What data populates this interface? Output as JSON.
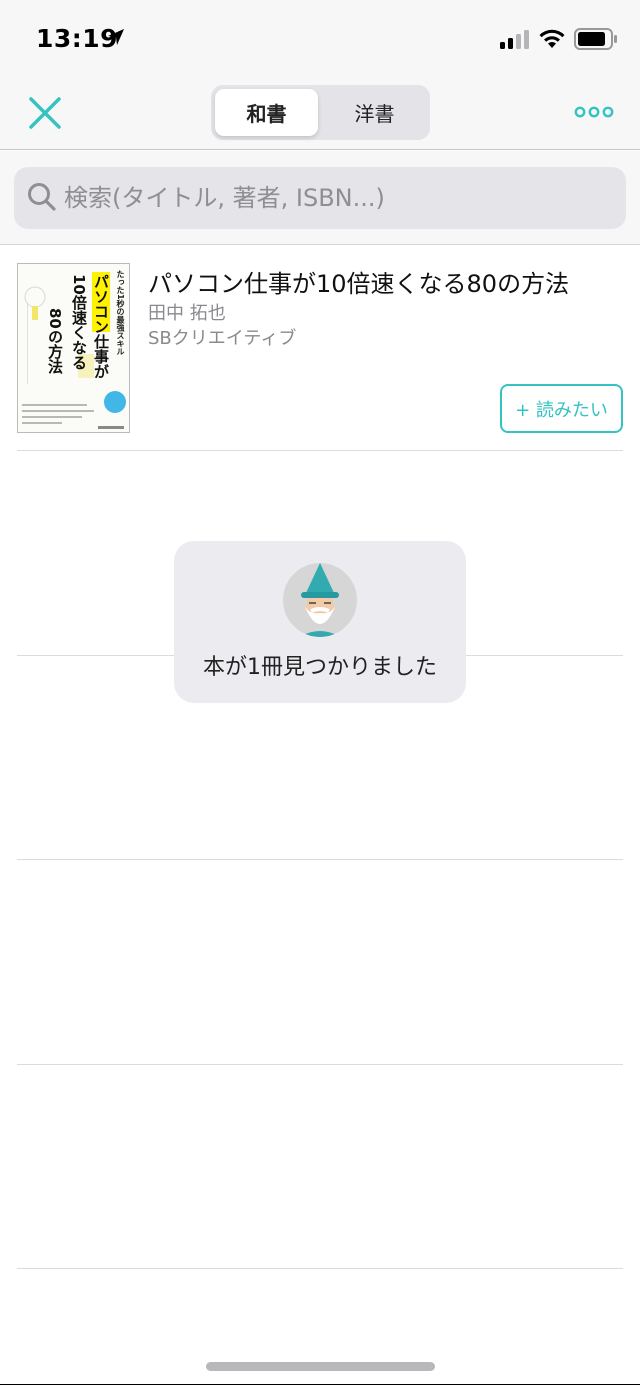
{
  "status_bar": {
    "time": "13:19"
  },
  "nav": {
    "tabs": [
      {
        "label": "和書",
        "active": true
      },
      {
        "label": "洋書",
        "active": false
      }
    ],
    "accent_color": "#34c3c2"
  },
  "search": {
    "placeholder": "検索(タイトル, 著者, ISBN...)",
    "value": ""
  },
  "book": {
    "title": "パソコン仕事が10倍速くなる80の方法",
    "author": "田中 拓也",
    "publisher": "SBクリエイティブ",
    "want_label": "+ 読みたい",
    "cover": {
      "top_text": "たった1秒の最強スキル",
      "line1": "パソコン仕事が",
      "line2": "10倍速くなる",
      "line3": "80の方法"
    }
  },
  "toast": {
    "message": "本が1冊見つかりました"
  }
}
